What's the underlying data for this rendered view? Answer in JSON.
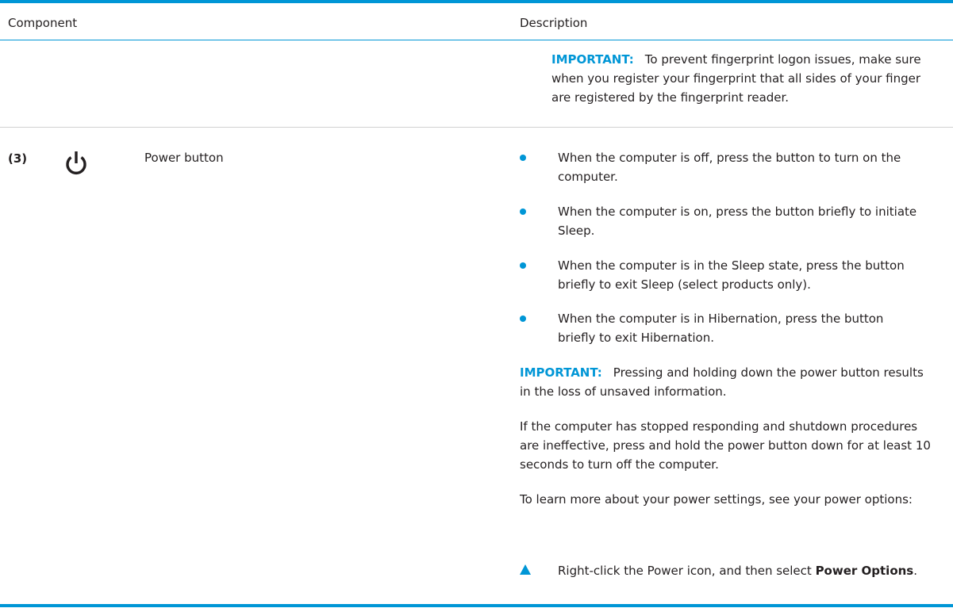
{
  "table": {
    "headers": {
      "component": "Component",
      "description": "Description"
    },
    "row_prev": {
      "important_label": "IMPORTANT:",
      "important_text": "To prevent fingerprint logon issues, make sure when you register your fingerprint that all sides of your finger are registered by the fingerprint reader."
    },
    "row": {
      "callout": "(3)",
      "icon": "power-icon",
      "name": "Power button",
      "bullets": [
        "When the computer is off, press the button to turn on the computer.",
        "When the computer is on, press the button briefly to initiate Sleep.",
        "When the computer is in the Sleep state, press the button briefly to exit Sleep (select products only).",
        "When the computer is in Hibernation, press the button briefly to exit Hibernation."
      ],
      "important_label": "IMPORTANT:",
      "important_text": "Pressing and holding down the power button results in the loss of unsaved information.",
      "note": "If the computer has stopped responding and shutdown procedures are ineffective, press and hold the power button down for at least 10 seconds to turn off the computer.",
      "learn_more": "To learn more about your power settings, see your power options:",
      "step": {
        "prefix": "Right-click the Power icon, and then select ",
        "bold": "Power Options",
        "suffix": "."
      }
    }
  },
  "colors": {
    "accent": "#0096d6",
    "text": "#231f20"
  }
}
